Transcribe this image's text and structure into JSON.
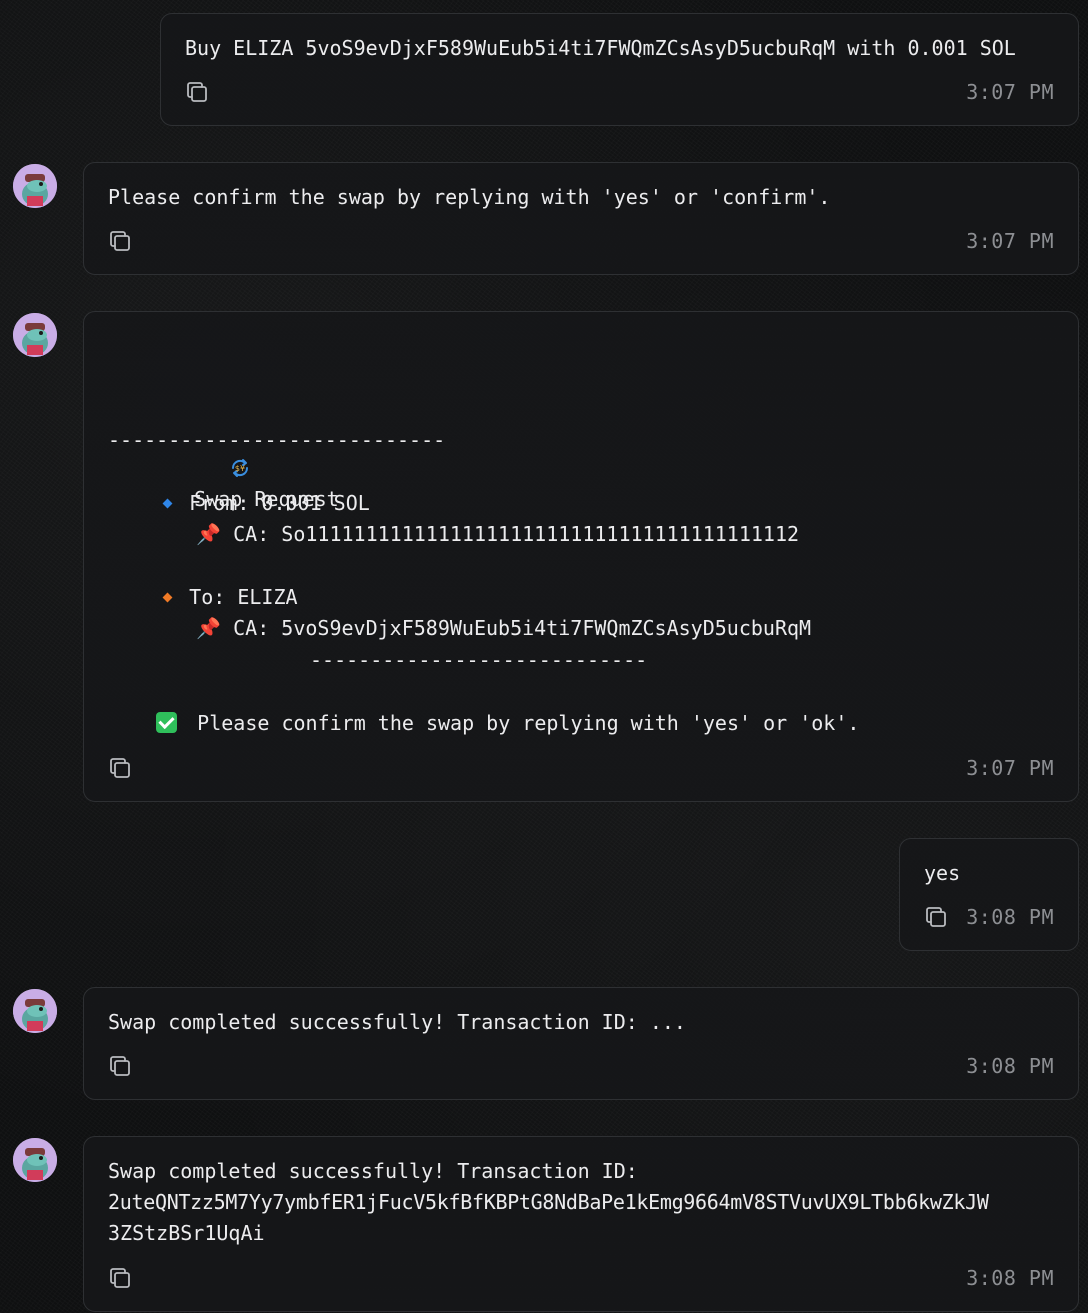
{
  "messages": [
    {
      "role": "user",
      "text": "Buy ELIZA 5voS9evDjxF589WuEub5i4ti7FWQmZCsAsyD5ucbuRqM with 0.001 SOL",
      "time": "3:07 PM"
    },
    {
      "role": "agent",
      "text": "Please confirm the swap by replying with 'yes' or 'confirm'.",
      "time": "3:07 PM"
    },
    {
      "role": "agent",
      "swap": {
        "title": "Swap Request",
        "divider": "----------------------------",
        "from_label": "From: 0.001 SOL",
        "from_ca": "CA: So11111111111111111111111111111111111111112",
        "to_label": "To: ELIZA",
        "to_ca": "CA: 5voS9evDjxF589WuEub5i4ti7FWQmZCsAsyD5ucbuRqM",
        "divider2": "----------------------------",
        "confirm": "Please confirm the swap by replying with 'yes' or 'ok'."
      },
      "time": "3:07 PM"
    },
    {
      "role": "user",
      "text": "yes",
      "time": "3:08 PM"
    },
    {
      "role": "agent",
      "text": "Swap completed successfully! Transaction ID: ...",
      "time": "3:08 PM"
    },
    {
      "role": "agent",
      "lines": [
        "Swap completed successfully! Transaction ID:",
        "2uteQNTzz5M7Yy7ymbfER1jFucV5kfBfKBPtG8NdBaPe1kEmg9664mV8STVuvUX9LTbb6kwZkJW",
        "3ZStzBSr1UqAi"
      ],
      "time": "3:08 PM"
    }
  ],
  "icons": {
    "copy": "copy-icon",
    "avatar": "agent-avatar",
    "swap": "swap-arrows-icon",
    "pin": "pushpin-icon",
    "check": "check-mark-icon"
  },
  "colors": {
    "background": "#101112",
    "bubble": "#161719",
    "border": "#2e3033",
    "text": "#ececee",
    "muted": "#8d8f93",
    "check": "#2fbf5b"
  }
}
